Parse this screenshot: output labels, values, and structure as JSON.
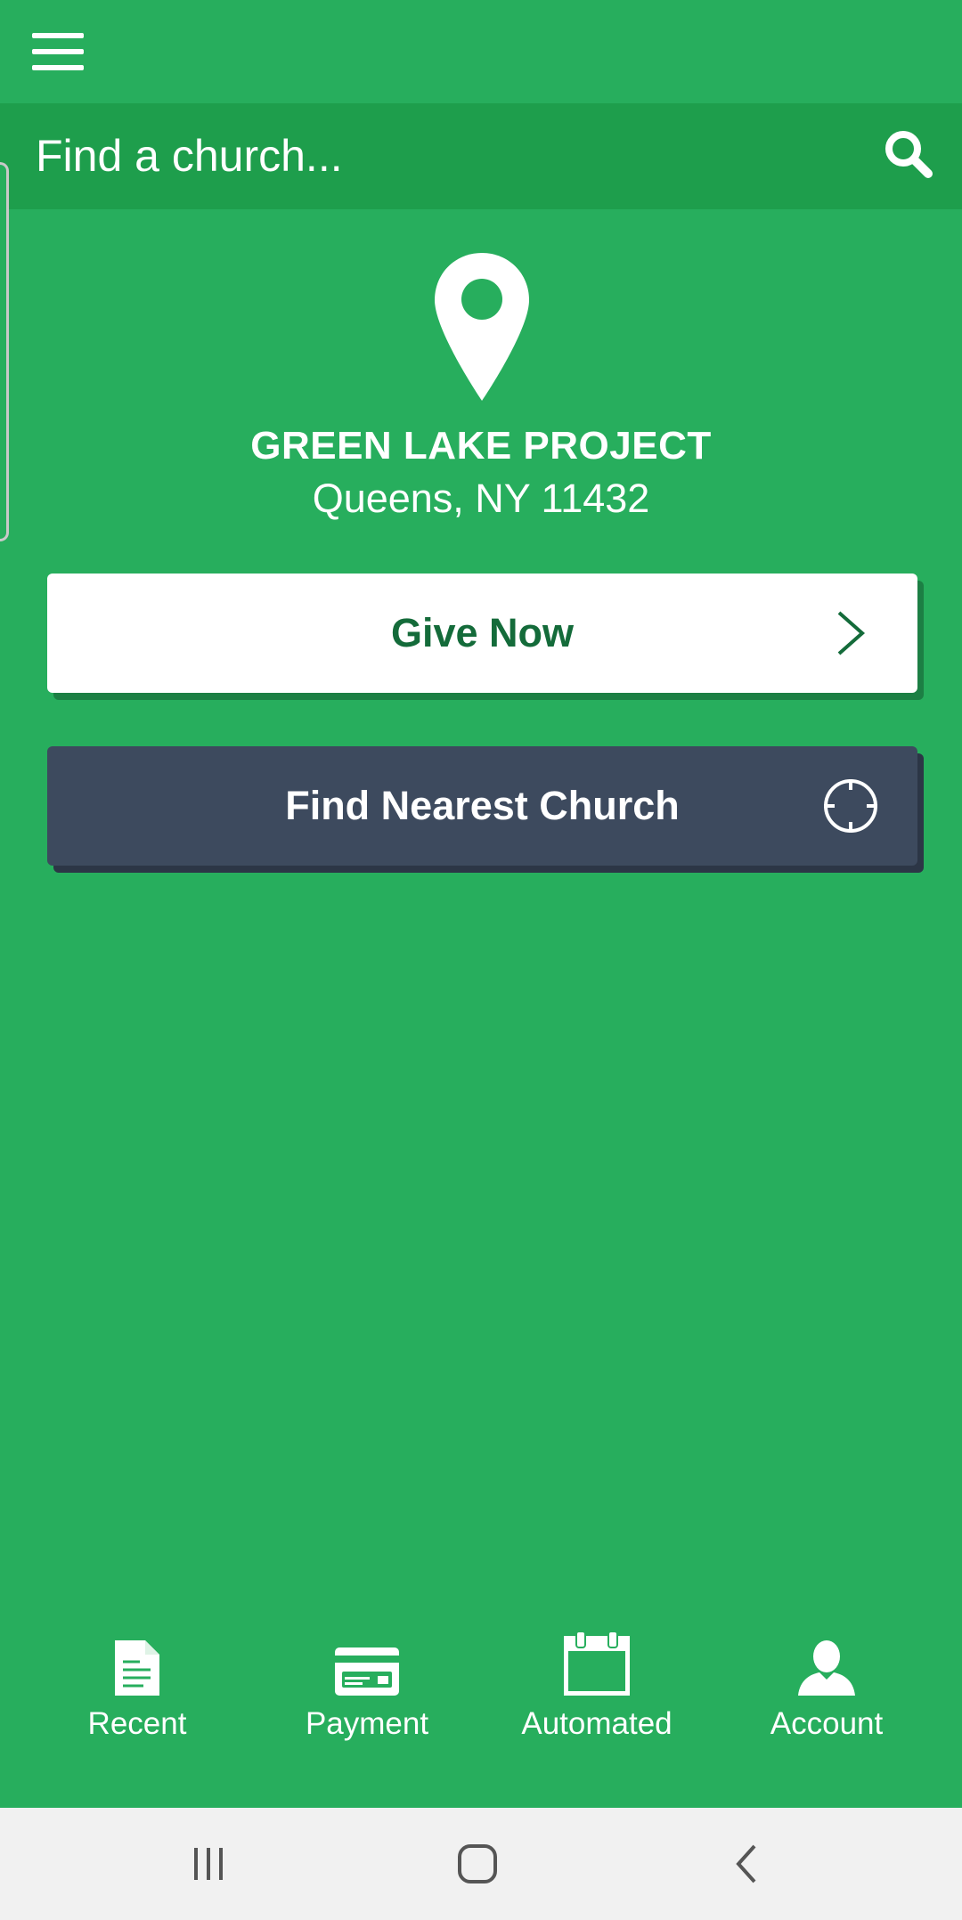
{
  "search": {
    "placeholder": "Find a church..."
  },
  "church": {
    "name": "GREEN LAKE PROJECT",
    "location": "Queens, NY 11432"
  },
  "actions": {
    "give_label": "Give Now",
    "find_label": "Find Nearest Church"
  },
  "bottom_nav": {
    "items": [
      {
        "label": "Recent",
        "icon": "document-icon"
      },
      {
        "label": "Payment",
        "icon": "credit-card-icon"
      },
      {
        "label": "Automated",
        "icon": "calendar-icon"
      },
      {
        "label": "Account",
        "icon": "person-icon"
      }
    ]
  },
  "colors": {
    "background": "#27ae5d",
    "search_bar": "#1e9e4c",
    "find_button": "#3d4a5e",
    "give_text": "#146b3a",
    "system_bar": "#f1f1f1"
  }
}
